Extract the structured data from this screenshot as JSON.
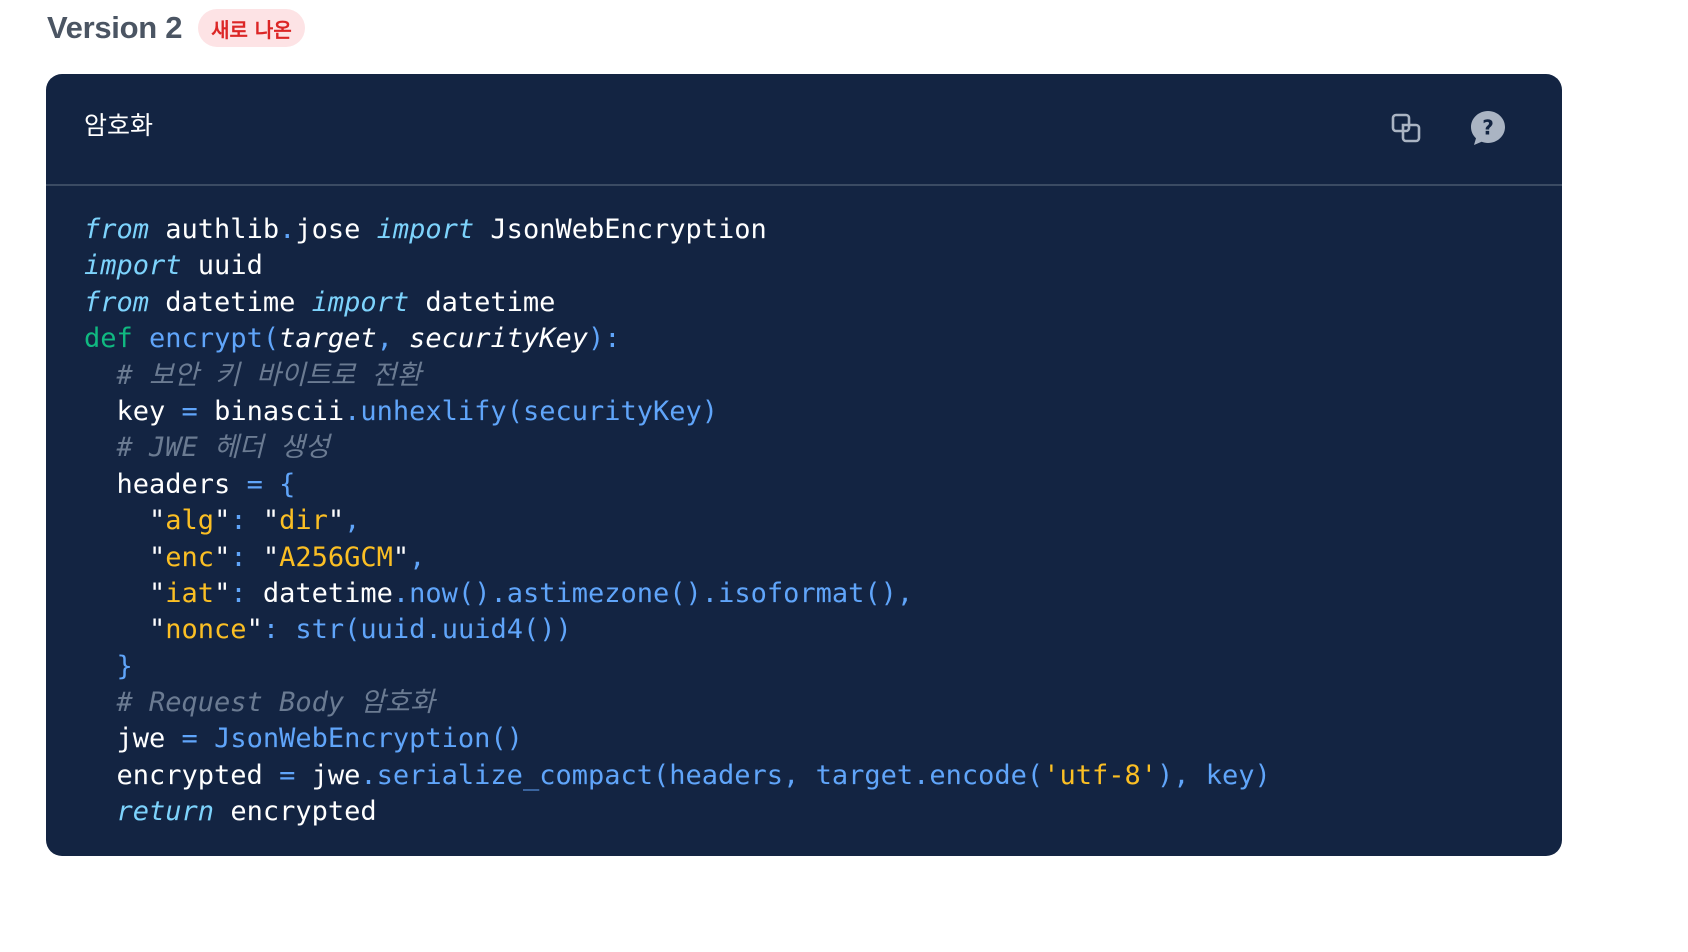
{
  "version": {
    "title": "Version 2",
    "badge": "새로 나온"
  },
  "code_block": {
    "title": "암호화",
    "copy_icon": "copy-icon",
    "help_icon": "help-icon",
    "colors": {
      "background": "#132442",
      "keyword": "#7dd3fc",
      "def_keyword": "#10b981",
      "function": "#60a5fa",
      "comment": "#6b7b92",
      "string": "#fbbf24"
    },
    "lines": [
      [
        [
          "kw-i",
          "from"
        ],
        [
          "plain",
          " authlib"
        ],
        [
          "punc",
          "."
        ],
        [
          "plain",
          "jose "
        ],
        [
          "kw-i",
          "import"
        ],
        [
          "plain",
          " JsonWebEncryption"
        ]
      ],
      [
        [
          "kw-i",
          "import"
        ],
        [
          "plain",
          " uuid"
        ]
      ],
      [
        [
          "kw-i",
          "from"
        ],
        [
          "plain",
          " datetime "
        ],
        [
          "kw-i",
          "import"
        ],
        [
          "plain",
          " datetime"
        ]
      ],
      [
        [
          "kw-def",
          "def"
        ],
        [
          "plain",
          " "
        ],
        [
          "fn",
          "encrypt"
        ],
        [
          "punc",
          "("
        ],
        [
          "param",
          "target"
        ],
        [
          "punc",
          ", "
        ],
        [
          "param",
          "securityKey"
        ],
        [
          "punc",
          "):"
        ]
      ],
      [
        [
          "plain",
          "  "
        ],
        [
          "cmt",
          "# 보안 키 바이트로 전환"
        ]
      ],
      [
        [
          "plain",
          "  key "
        ],
        [
          "punc",
          "="
        ],
        [
          "plain",
          " binascii"
        ],
        [
          "punc",
          "."
        ],
        [
          "fn",
          "unhexlify"
        ],
        [
          "punc",
          "("
        ],
        [
          "fn",
          "securityKey"
        ],
        [
          "punc",
          ")"
        ]
      ],
      [
        [
          "plain",
          "  "
        ],
        [
          "cmt",
          "# JWE 헤더 생성"
        ]
      ],
      [
        [
          "plain",
          "  headers "
        ],
        [
          "punc",
          "="
        ],
        [
          "plain",
          " "
        ],
        [
          "punc",
          "{"
        ]
      ],
      [
        [
          "plain",
          "    \""
        ],
        [
          "str",
          "alg"
        ],
        [
          "plain",
          "\""
        ],
        [
          "punc",
          ":"
        ],
        [
          "plain",
          " \""
        ],
        [
          "str",
          "dir"
        ],
        [
          "plain",
          "\""
        ],
        [
          "punc",
          ","
        ]
      ],
      [
        [
          "plain",
          "    \""
        ],
        [
          "str",
          "enc"
        ],
        [
          "plain",
          "\""
        ],
        [
          "punc",
          ":"
        ],
        [
          "plain",
          " \""
        ],
        [
          "str",
          "A256GCM"
        ],
        [
          "plain",
          "\""
        ],
        [
          "punc",
          ","
        ]
      ],
      [
        [
          "plain",
          "    \""
        ],
        [
          "str",
          "iat"
        ],
        [
          "plain",
          "\""
        ],
        [
          "punc",
          ":"
        ],
        [
          "plain",
          " datetime"
        ],
        [
          "punc",
          "."
        ],
        [
          "fn",
          "now"
        ],
        [
          "punc",
          "()."
        ],
        [
          "fn",
          "astimezone"
        ],
        [
          "punc",
          "()."
        ],
        [
          "fn",
          "isoformat"
        ],
        [
          "punc",
          "(),"
        ]
      ],
      [
        [
          "plain",
          "    \""
        ],
        [
          "str",
          "nonce"
        ],
        [
          "plain",
          "\""
        ],
        [
          "punc",
          ":"
        ],
        [
          "plain",
          " "
        ],
        [
          "fn",
          "str"
        ],
        [
          "punc",
          "("
        ],
        [
          "fn",
          "uuid"
        ],
        [
          "punc",
          "."
        ],
        [
          "fn",
          "uuid4"
        ],
        [
          "punc",
          "())"
        ]
      ],
      [
        [
          "plain",
          "  "
        ],
        [
          "punc",
          "}"
        ]
      ],
      [
        [
          "plain",
          "  "
        ],
        [
          "cmt",
          "# Request Body 암호화"
        ]
      ],
      [
        [
          "plain",
          "  jwe "
        ],
        [
          "punc",
          "="
        ],
        [
          "plain",
          " "
        ],
        [
          "fn",
          "JsonWebEncryption"
        ],
        [
          "punc",
          "()"
        ]
      ],
      [
        [
          "plain",
          "  encrypted "
        ],
        [
          "punc",
          "="
        ],
        [
          "plain",
          " jwe"
        ],
        [
          "punc",
          "."
        ],
        [
          "fn",
          "serialize_compact"
        ],
        [
          "punc",
          "("
        ],
        [
          "fn",
          "headers"
        ],
        [
          "punc",
          ", "
        ],
        [
          "fn",
          "target"
        ],
        [
          "punc",
          "."
        ],
        [
          "fn",
          "encode"
        ],
        [
          "punc",
          "("
        ],
        [
          "str",
          "'utf-8'"
        ],
        [
          "punc",
          "), "
        ],
        [
          "fn",
          "key"
        ],
        [
          "punc",
          ")"
        ]
      ],
      [
        [
          "plain",
          "  "
        ],
        [
          "kw-i",
          "return"
        ],
        [
          "plain",
          " encrypted"
        ]
      ]
    ]
  }
}
